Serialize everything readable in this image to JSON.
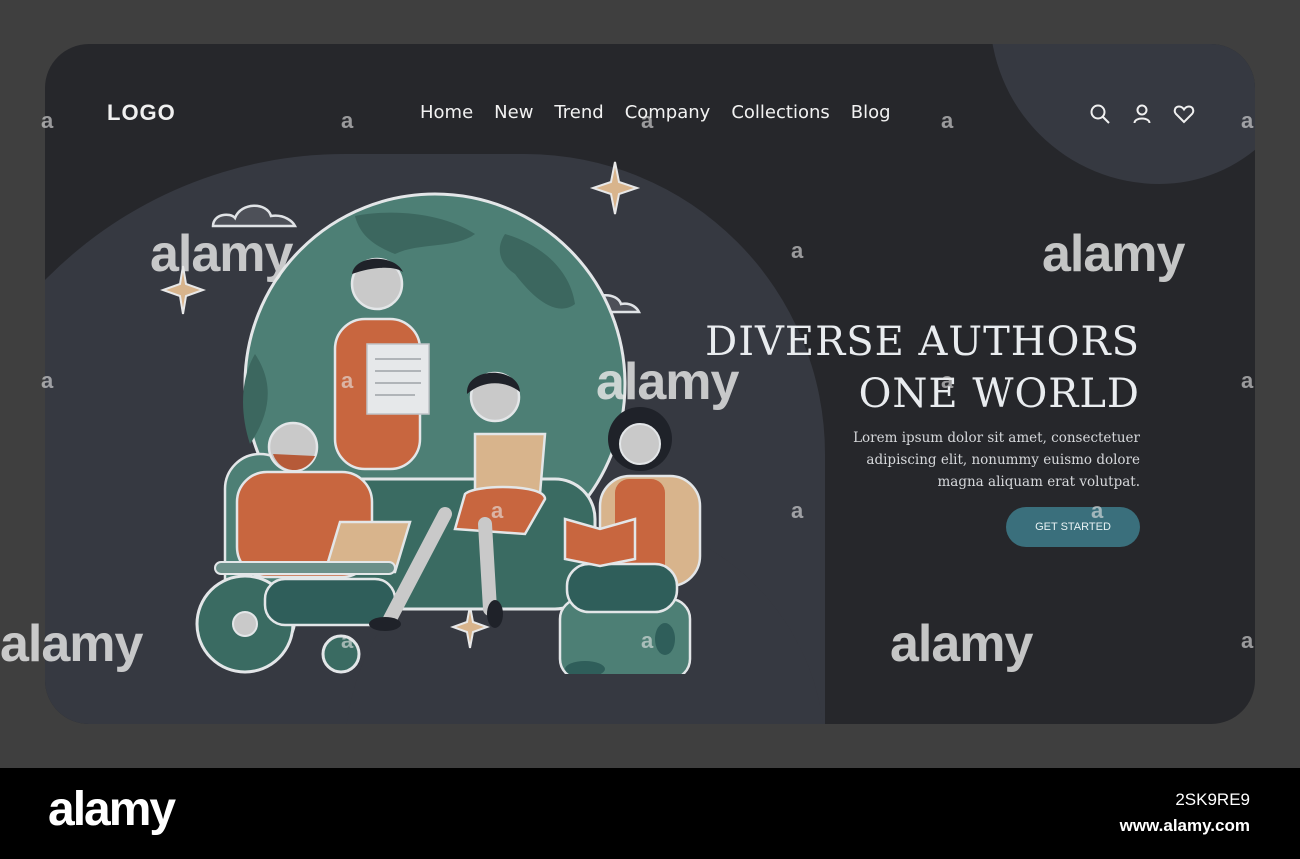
{
  "header": {
    "logo": "LOGO",
    "nav": [
      "Home",
      "New",
      "Trend",
      "Company",
      "Collections",
      "Blog"
    ],
    "icons": [
      "search-icon",
      "user-icon",
      "heart-icon"
    ]
  },
  "hero": {
    "title_line1": "DIVERSE AUTHORS",
    "title_line2": "ONE WORLD",
    "body": "Lorem ipsum dolor sit amet, consectetuer adipiscing elit, nonummy euismo dolore magna aliquam erat volutpat.",
    "cta": "GET STARTED"
  },
  "watermark": {
    "word": "alamy",
    "letter": "a",
    "image_id": "2SK9RE9",
    "url": "www.alamy.com"
  },
  "colors": {
    "background": "#3f3f3f",
    "card": "#26272b",
    "accent": "#3a6f7c",
    "globe": "#4d7f75",
    "orange": "#c8663f",
    "beige": "#d8b48c"
  }
}
